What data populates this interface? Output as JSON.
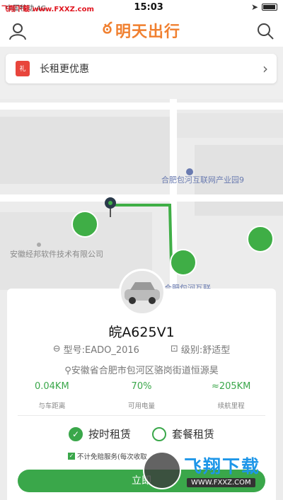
{
  "statusbar": {
    "carrier": "中国移动 4G",
    "time": "15:03"
  },
  "watermark": {
    "tl": "飞翔下载 www.FXXZ.com",
    "brand": "飞翔下载",
    "url": "WWW.FXXZ.COM"
  },
  "header": {
    "title": "明天出行"
  },
  "promo": {
    "text": "长租更优惠",
    "gift": "礼"
  },
  "map_labels": {
    "park": "合肥包河互联网产业园9",
    "company": "安徽经邦软件技术有限公司",
    "park2": "合肥包河互联",
    "street": "有限公司"
  },
  "car": {
    "plate": "皖A625V1",
    "model": "型号:EADO_2016",
    "level": "级别:舒适型",
    "address": "安徽省合肥市包河区骆岗街道恒源昊"
  },
  "stats": [
    {
      "value": "0.04KM",
      "label": "与车距离"
    },
    {
      "value": "70%",
      "label": "可用电量"
    },
    {
      "value": "≈205KM",
      "label": "续航里程"
    }
  ],
  "modes": {
    "hourly": "按时租赁",
    "package": "套餐租赁"
  },
  "insurance": "不计免赔服务(每次收取",
  "button": "立即"
}
